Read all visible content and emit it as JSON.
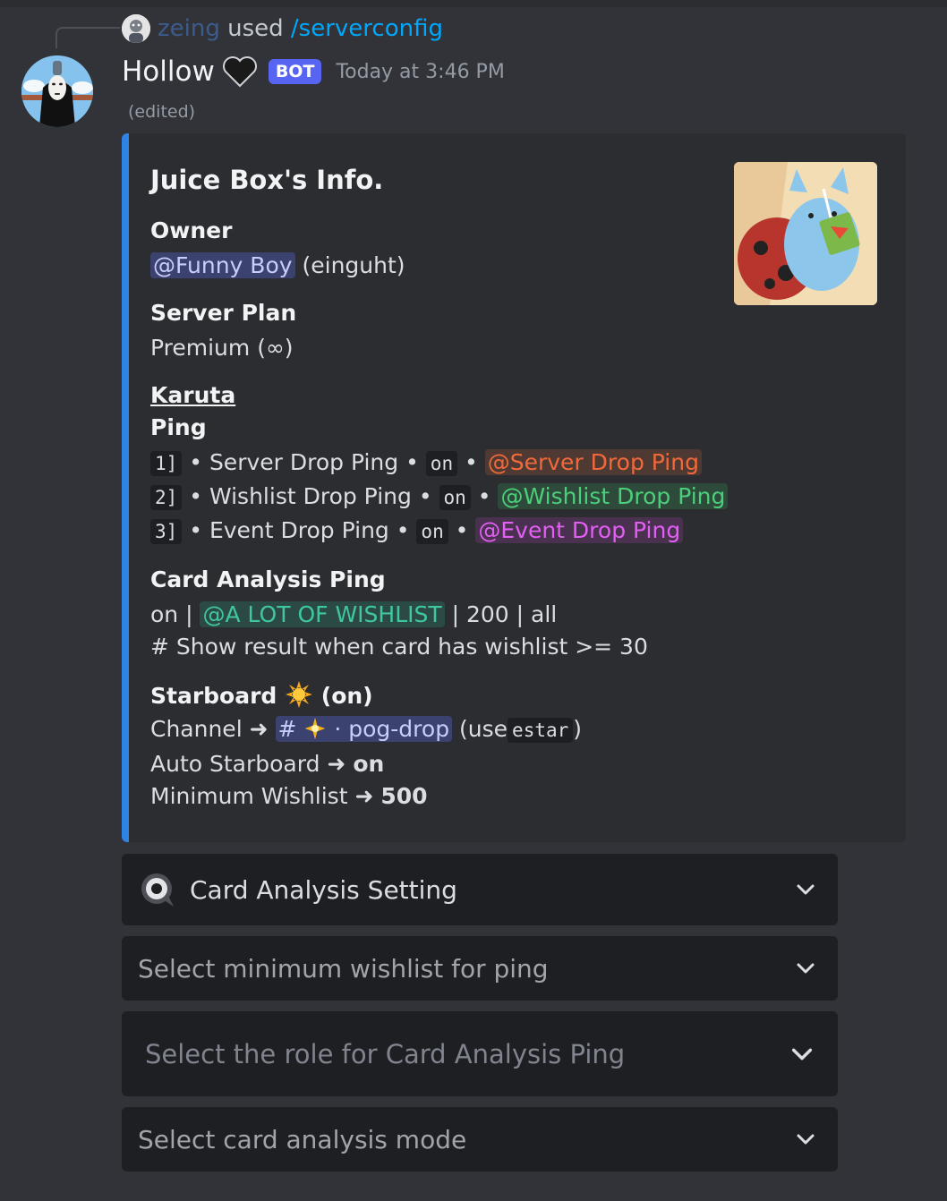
{
  "reply": {
    "username": "zeing",
    "used_text": "used",
    "command": "/serverconfig"
  },
  "message": {
    "author": "Hollow",
    "bot_tag": "BOT",
    "timestamp": "Today at 3:46 PM",
    "edited": "(edited)"
  },
  "embed": {
    "title": "Juice Box's Info.",
    "owner": {
      "name": "Owner",
      "mention": "@Funny Boy",
      "handle": "(einguht)"
    },
    "server_plan": {
      "name": "Server Plan",
      "value": "Premium (∞)"
    },
    "karuta": {
      "heading": "Karuta",
      "ping_heading": "Ping",
      "pings": [
        {
          "index": "1]",
          "label": "Server Drop Ping",
          "state": "on",
          "role": "@Server Drop Ping"
        },
        {
          "index": "2]",
          "label": "Wishlist Drop Ping",
          "state": "on",
          "role": "@Wishlist Drop Ping"
        },
        {
          "index": "3]",
          "label": "Event Drop Ping",
          "state": "on",
          "role": "@Event Drop Ping"
        }
      ]
    },
    "card_analysis": {
      "name": "Card Analysis Ping",
      "state": "on",
      "role": "@A LOT OF WISHLIST",
      "amount": "200",
      "mode": "all",
      "note": "# Show result when card has wishlist >= 30"
    },
    "starboard": {
      "name": "Starboard",
      "state": "(on)",
      "channel_label": "Channel",
      "channel_hash": "#",
      "channel_name": "pog-drop",
      "use_prefix": "(use",
      "use_command": "estar",
      "use_suffix": ")",
      "auto_label": "Auto Starboard",
      "auto_value": "on",
      "min_label": "Minimum Wishlist",
      "min_value": "500"
    }
  },
  "components": {
    "select_1": "Card Analysis Setting",
    "select_2": "Select minimum wishlist for ping",
    "select_3": "Select the role for Card Analysis Ping",
    "select_4": "Select card analysis mode"
  },
  "colors": {
    "embed_border": "#2f83e4",
    "bot_tag": "#5865f2",
    "command_link": "#00a8fc"
  },
  "icons": [
    "heart-icon",
    "sun-icon",
    "arrow-icon",
    "chevron-down-icon",
    "speech-bubble-icon"
  ]
}
